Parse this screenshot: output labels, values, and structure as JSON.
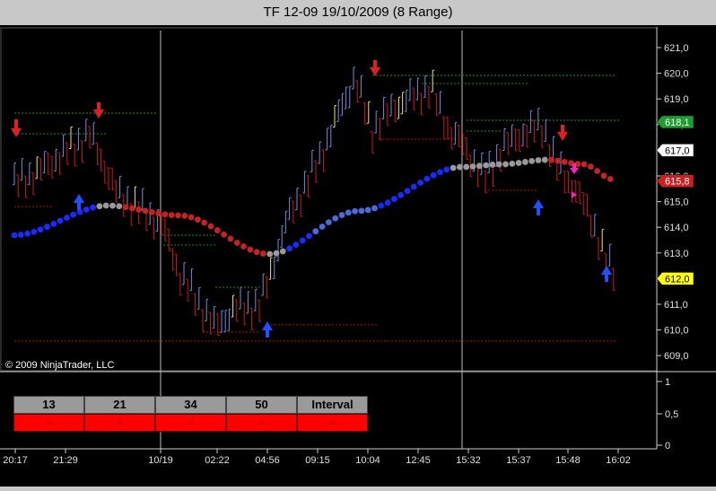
{
  "window": {
    "title": "TF 12-09  19/10/2009 (8 Range)"
  },
  "copyright": "© 2009 NinjaTrader, LLC",
  "price_axis": {
    "ticks": [
      "621,0",
      "620,0",
      "619,0",
      "618,0",
      "617,0",
      "616,0",
      "615,0",
      "614,0",
      "613,0",
      "612,0",
      "611,0",
      "610,0",
      "609,0"
    ],
    "markers": [
      {
        "label": "618,1",
        "color": "#1e9e2e",
        "text_color": "#ffffff"
      },
      {
        "label": "617,0",
        "color": "#ffffff",
        "text_color": "#000000"
      },
      {
        "label": "615,8",
        "color": "#cc1f1f",
        "text_color": "#ffffff"
      },
      {
        "label": "612,0",
        "color": "#ffff00",
        "text_color": "#000000"
      }
    ]
  },
  "indicator_axis": {
    "ticks": [
      "1",
      "0,5",
      "0"
    ]
  },
  "time_axis": {
    "ticks": [
      "20:17",
      "21:29",
      "10/19",
      "02:22",
      "04:56",
      "09:15",
      "10:04",
      "12:45",
      "15:32",
      "15:37",
      "15:48",
      "16:02"
    ]
  },
  "grid_table": {
    "headers": [
      "13",
      "21",
      "34",
      "50",
      "Interval"
    ],
    "cells": [
      "o",
      "o",
      "o",
      "o",
      "o"
    ],
    "cell_color": "#ff0000"
  },
  "colors": {
    "up_bar": "#6f8fd8",
    "down_bar": "#d01818",
    "ma_up": "#1a2bff",
    "ma_down": "#c02424",
    "ma_flat": "#9a9a9a",
    "background": "#000000"
  }
}
